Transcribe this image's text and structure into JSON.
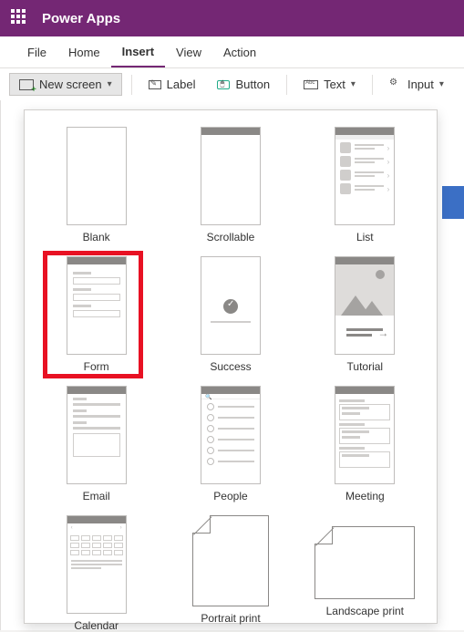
{
  "titlebar": {
    "app_name": "Power Apps"
  },
  "menu": {
    "file": "File",
    "home": "Home",
    "insert": "Insert",
    "view": "View",
    "action": "Action"
  },
  "toolbar": {
    "new_screen": "New screen",
    "label": "Label",
    "button": "Button",
    "text": "Text",
    "input": "Input"
  },
  "templates": {
    "blank": "Blank",
    "scrollable": "Scrollable",
    "list": "List",
    "form": "Form",
    "success": "Success",
    "tutorial": "Tutorial",
    "email": "Email",
    "people": "People",
    "meeting": "Meeting",
    "calendar": "Calendar",
    "portrait_print": "Portrait print",
    "landscape_print": "Landscape print"
  }
}
